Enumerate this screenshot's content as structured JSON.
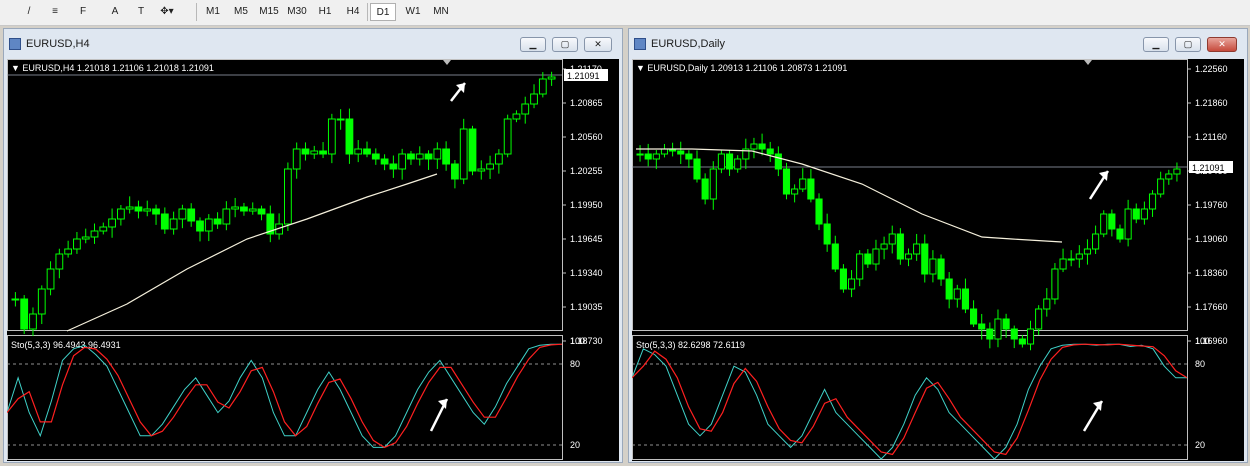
{
  "toolbar": {
    "buttons": [
      {
        "name": "line-tool-icon",
        "glyph": "/"
      },
      {
        "name": "fibo-tool-icon",
        "glyph": "≡"
      },
      {
        "name": "fibo-fan-icon",
        "glyph": "F"
      },
      {
        "name": "text-tool-label",
        "glyph": "A"
      },
      {
        "name": "text-label-tool",
        "glyph": "T"
      },
      {
        "name": "arrows-tool-icon",
        "glyph": "✥▾"
      }
    ],
    "timeframes": [
      "M1",
      "M5",
      "M15",
      "M30",
      "H1",
      "H4",
      "D1",
      "W1",
      "MN"
    ],
    "active_timeframe": "D1"
  },
  "windows": [
    {
      "title": "EURUSD,H4",
      "header": "EURUSD,H4  1.21018 1.21106 1.21018 1.21091",
      "price_labels": [
        "1.21170",
        "1.20865",
        "1.20560",
        "1.20255",
        "1.19950",
        "1.19645",
        "1.19340",
        "1.19035",
        "1.18730"
      ],
      "current_price": "1.21091",
      "sto_header": "Sto(5,3,3) 96.4943 96.4931",
      "sto_levels": [
        "100",
        "80",
        "20"
      ]
    },
    {
      "title": "EURUSD,Daily",
      "header": "EURUSD,Daily  1.20913 1.21106 1.20873 1.21091",
      "price_labels": [
        "1.22560",
        "1.21860",
        "1.21160",
        "1.20460",
        "1.19760",
        "1.19060",
        "1.18360",
        "1.17660",
        "1.16960"
      ],
      "current_price": "1.21091",
      "sto_header": "Sto(5,3,3) 82.6298 72.6119",
      "sto_levels": [
        "100",
        "80",
        "20"
      ]
    }
  ],
  "colors": {
    "bull": "#00ff00",
    "bear": "#00ff00",
    "ma": "#f5f0dc",
    "k_line": "#3fd1c8",
    "d_line": "#ff2020",
    "arrow": "#ffffff",
    "grid": "#c0c0c0"
  }
}
